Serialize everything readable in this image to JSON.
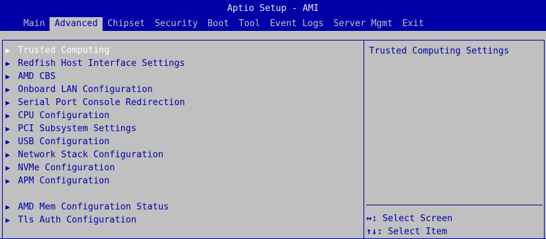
{
  "title": "Aptio Setup - AMI",
  "menu": [
    {
      "label": "Main",
      "active": false
    },
    {
      "label": "Advanced",
      "active": true
    },
    {
      "label": "Chipset",
      "active": false
    },
    {
      "label": "Security",
      "active": false
    },
    {
      "label": "Boot",
      "active": false
    },
    {
      "label": "Tool",
      "active": false
    },
    {
      "label": "Event Logs",
      "active": false
    },
    {
      "label": "Server Mgmt",
      "active": false
    },
    {
      "label": "Exit",
      "active": false
    }
  ],
  "items": [
    {
      "label": "Trusted Computing"
    },
    {
      "label": "Redfish Host Interface Settings"
    },
    {
      "label": "AMD CBS"
    },
    {
      "label": "Onboard LAN Configuration"
    },
    {
      "label": "Serial Port Console Redirection"
    },
    {
      "label": "CPU Configuration"
    },
    {
      "label": "PCI Subsystem Settings"
    },
    {
      "label": "USB Configuration"
    },
    {
      "label": "Network Stack Configuration"
    },
    {
      "label": "NVMe Configuration"
    },
    {
      "label": "APM Configuration"
    },
    {
      "label": "AMD Mem Configuration Status"
    },
    {
      "label": "Tls Auth Configuration"
    }
  ],
  "selected_item": "Trusted Computing",
  "help": {
    "text": "Trusted Computing Settings"
  },
  "keyhelp": [
    {
      "keys": "↔:",
      "action": "Select Screen"
    },
    {
      "keys": "↑↓:",
      "action": "Select Item"
    }
  ],
  "colors": {
    "header_bg": "#0000a8",
    "content_bg": "#c0c0c0",
    "text": "#0000a8",
    "selected_text": "#ffffff"
  }
}
